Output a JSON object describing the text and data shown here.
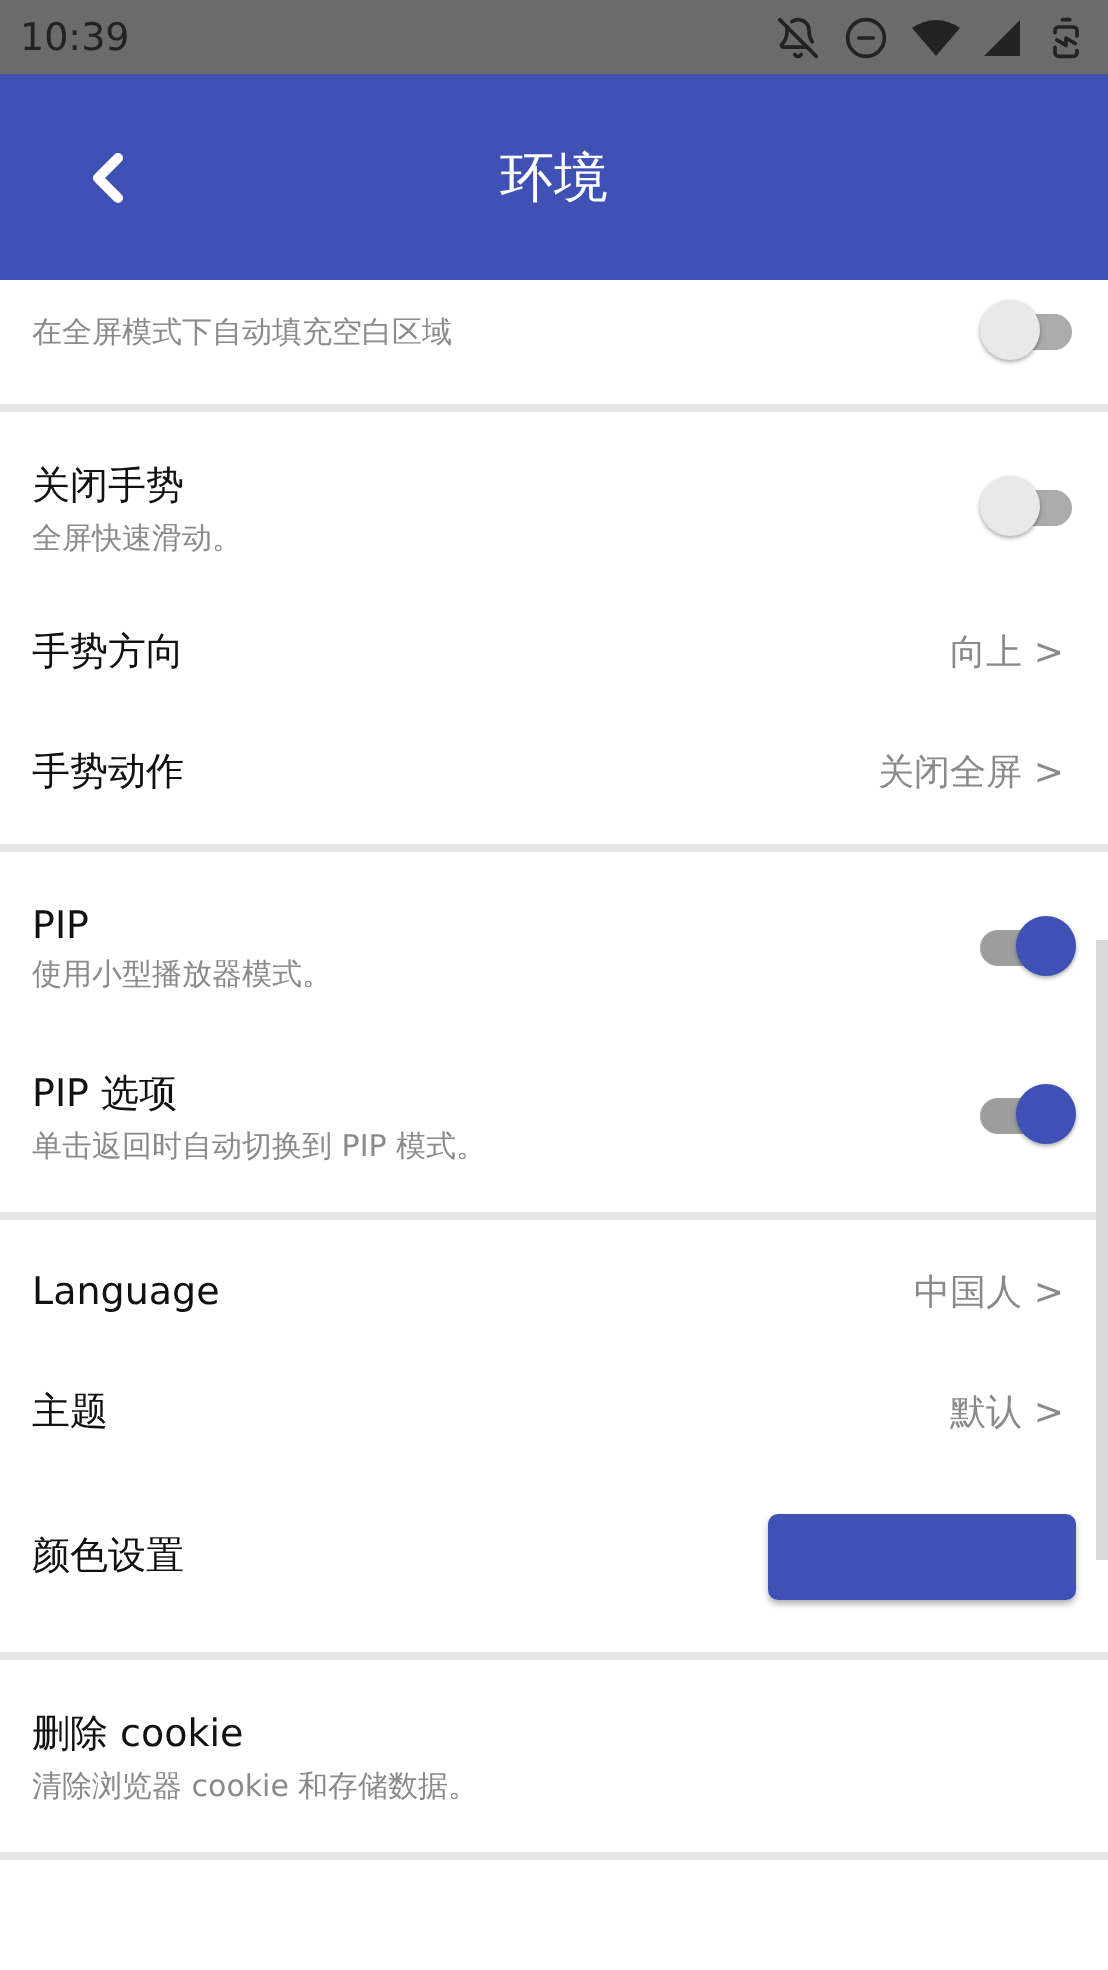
{
  "status_bar": {
    "time": "10:39"
  },
  "app_bar": {
    "title": "环境"
  },
  "sections": [
    {
      "items": [
        {
          "kind": "toggle",
          "subtitle": "在全屏模式下自动填充空白区域",
          "on": false
        }
      ]
    },
    {
      "items": [
        {
          "kind": "toggle",
          "title": "关闭手势",
          "subtitle": "全屏快速滑动。",
          "on": false
        },
        {
          "kind": "value",
          "title": "手势方向",
          "value": "向上 >"
        },
        {
          "kind": "value",
          "title": "手势动作",
          "value": "关闭全屏 >"
        }
      ]
    },
    {
      "items": [
        {
          "kind": "toggle",
          "title": "PIP",
          "subtitle": "使用小型播放器模式。",
          "on": true
        },
        {
          "kind": "toggle",
          "title": "PIP 选项",
          "subtitle": "单击返回时自动切换到 PIP 模式。",
          "on": true
        }
      ]
    },
    {
      "items": [
        {
          "kind": "value",
          "title": "Language",
          "value": "中国人 >"
        },
        {
          "kind": "value",
          "title": "主题",
          "value": "默认 >"
        },
        {
          "kind": "color",
          "title": "颜色设置",
          "color": "#3f51b5"
        }
      ]
    },
    {
      "items": [
        {
          "kind": "action",
          "title": "删除 cookie",
          "subtitle": "清除浏览器 cookie 和存储数据。"
        }
      ]
    }
  ]
}
